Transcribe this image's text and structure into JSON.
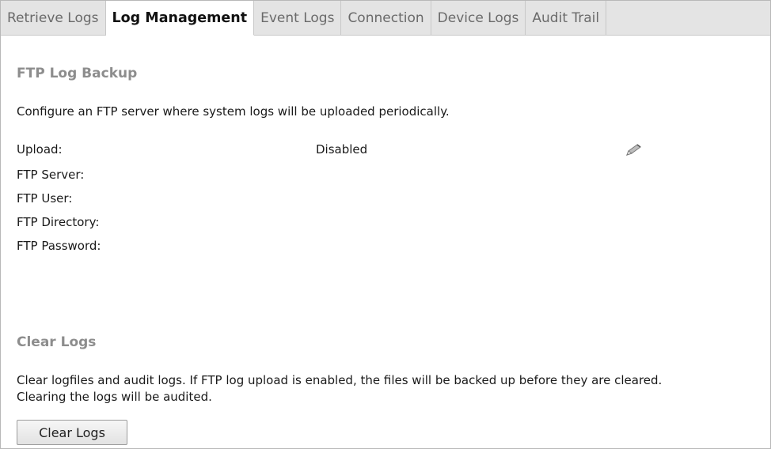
{
  "tabs": [
    {
      "label": "Retrieve Logs",
      "active": false
    },
    {
      "label": "Log Management",
      "active": true
    },
    {
      "label": "Event Logs",
      "active": false
    },
    {
      "label": "Connection",
      "active": false
    },
    {
      "label": "Device Logs",
      "active": false
    },
    {
      "label": "Audit Trail",
      "active": false
    }
  ],
  "ftp_backup": {
    "title": "FTP Log Backup",
    "description": "Configure an FTP server where system logs will be uploaded periodically.",
    "fields": {
      "upload": {
        "label": "Upload:",
        "value": "Disabled"
      },
      "server": {
        "label": "FTP Server:",
        "value": ""
      },
      "user": {
        "label": "FTP User:",
        "value": ""
      },
      "directory": {
        "label": "FTP Directory:",
        "value": ""
      },
      "password": {
        "label": "FTP Password:",
        "value": ""
      }
    },
    "edit_icon": "pencil-icon"
  },
  "clear_logs": {
    "title": "Clear Logs",
    "description_line1": "Clear logfiles and audit logs. If FTP log upload is enabled, the files will be backed up before they are cleared.",
    "description_line2": "Clearing the logs will be audited.",
    "button_label": "Clear Logs"
  },
  "colors": {
    "section_title": "#8d8d8d",
    "tabbar_bg": "#e4e4e4",
    "active_tab_bg": "#ffffff"
  }
}
